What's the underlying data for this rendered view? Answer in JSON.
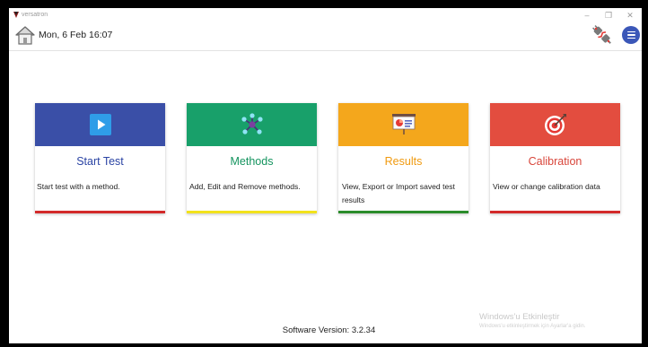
{
  "window": {
    "title": "versatron",
    "controls": {
      "minimize": "–",
      "maximize": "❐",
      "close": "✕"
    }
  },
  "header": {
    "datetime": "Mon, 6 Feb  16:07",
    "home_icon": "home-icon",
    "plug_icon": "plug-disconnected-icon",
    "menu_icon": "hamburger-menu-icon"
  },
  "cards": [
    {
      "title": "Start Test",
      "description": "Start test with a method.",
      "icon": "play-icon",
      "colors": {
        "band": "#3a4fa7",
        "title": "#2b44a4",
        "bottom": "#d32a2a"
      }
    },
    {
      "title": "Methods",
      "description": "Add, Edit and Remove methods.",
      "icon": "network-nodes-icon",
      "colors": {
        "band": "#18a06a",
        "title": "#15945f",
        "bottom": "#f2e21c"
      }
    },
    {
      "title": "Results",
      "description": "View, Export or Import saved test results",
      "icon": "presentation-chart-icon",
      "colors": {
        "band": "#f4a71c",
        "title": "#f09a10",
        "bottom": "#2b8c2b"
      }
    },
    {
      "title": "Calibration",
      "description": "View or change calibration data",
      "icon": "target-icon",
      "colors": {
        "band": "#e34d3f",
        "title": "#d8453a",
        "bottom": "#d32a2a"
      }
    }
  ],
  "footer": {
    "software_version": "Software Version:  3.2.34"
  },
  "watermark": {
    "title": "Windows'u Etkinleştir",
    "subtitle": "Windows'u etkinleştirmek için Ayarlar'a gidin."
  }
}
